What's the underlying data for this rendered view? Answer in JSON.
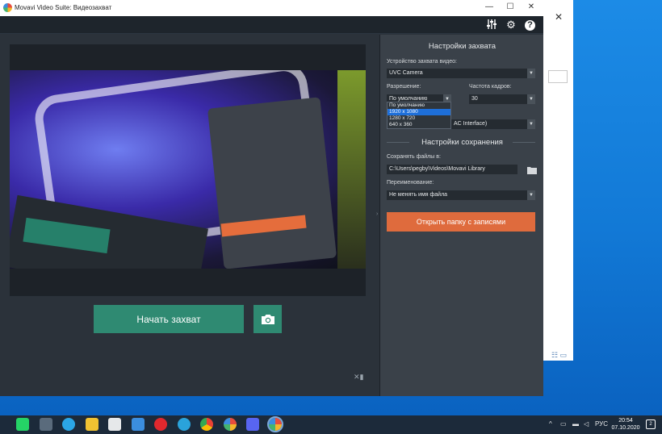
{
  "window": {
    "title": "Movavi Video Suite: Видеозахват",
    "minimize": "—",
    "maximize": "☐",
    "close": "✕"
  },
  "toolbar": {
    "icons": [
      "equalizer-icon",
      "gear-icon",
      "help-icon"
    ],
    "help_label": "?"
  },
  "preview": {
    "start_capture_label": "Начать захват",
    "snapshot_icon": "camera-icon"
  },
  "settings": {
    "capture_title": "Настройки захвата",
    "device_label": "Устройство захвата видео:",
    "device_value": "UVC Camera",
    "resolution_label": "Разрешение:",
    "resolution_value": "По умолчанию",
    "framerate_label": "Частота кадров:",
    "framerate_value": "30",
    "interface_value": "AC Interface)",
    "resolution_options": [
      "По умолчанию",
      "1920 x 1080",
      "1280 x 720",
      "640 x 360"
    ],
    "resolution_selected_index": 1,
    "save_title": "Настройки сохранения",
    "save_to_label": "Сохранять файлы в:",
    "save_to_value": "C:\\Users\\pegby\\Videos\\Movavi Library",
    "rename_label": "Переименование:",
    "rename_value": "Не менять имя файла",
    "open_folder_label": "Открыть папку с записями"
  },
  "taskbar": {
    "apps": [
      "whatsapp-icon",
      "camera-app-icon",
      "edge-icon",
      "file-explorer-icon",
      "store-icon",
      "mail-icon",
      "opera-icon",
      "telegram-icon",
      "chrome-icon",
      "paint-icon",
      "discord-icon",
      "movavi-icon"
    ],
    "language": "РУС",
    "time": "20:54",
    "date": "07.10.2020",
    "notifications": "2"
  },
  "colors": {
    "accent_green": "#2f8a72",
    "accent_orange": "#df6b3d",
    "panel_dark": "#2b323a",
    "selection_blue": "#1e6fd9"
  }
}
